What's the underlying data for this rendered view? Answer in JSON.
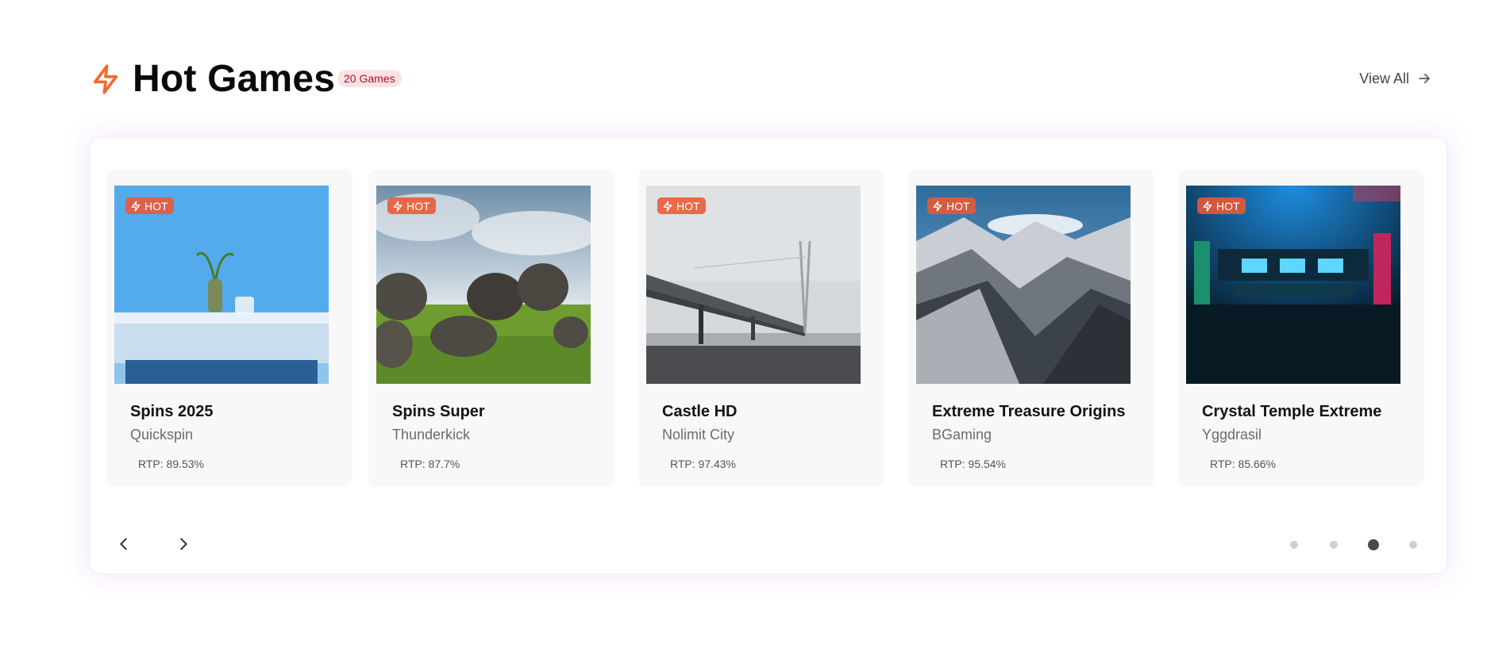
{
  "header": {
    "title": "Hot Games",
    "count_badge": "20 Games",
    "view_all": "View All",
    "accent_color": "#f26a2b"
  },
  "badge_label": "HOT",
  "games": [
    {
      "title": "Spins 2025",
      "provider": "Quickspin",
      "rtp": "RTP: 89.53%",
      "image": "vase-on-blue-table"
    },
    {
      "title": "Spins Super",
      "provider": "Thunderkick",
      "rtp": "RTP: 87.7%",
      "image": "boulders-on-grass"
    },
    {
      "title": "Castle HD",
      "provider": "Nolimit City",
      "rtp": "RTP: 97.43%",
      "image": "bridge-in-fog"
    },
    {
      "title": "Extreme Treasure Origins",
      "provider": "BGaming",
      "rtp": "RTP: 95.54%",
      "image": "snowy-mountains"
    },
    {
      "title": "Crystal Temple Extreme",
      "provider": "Yggdrasil",
      "rtp": "RTP: 85.66%",
      "image": "neon-arcade-room"
    }
  ],
  "carousel": {
    "page_count": 4,
    "active_page": 3
  }
}
